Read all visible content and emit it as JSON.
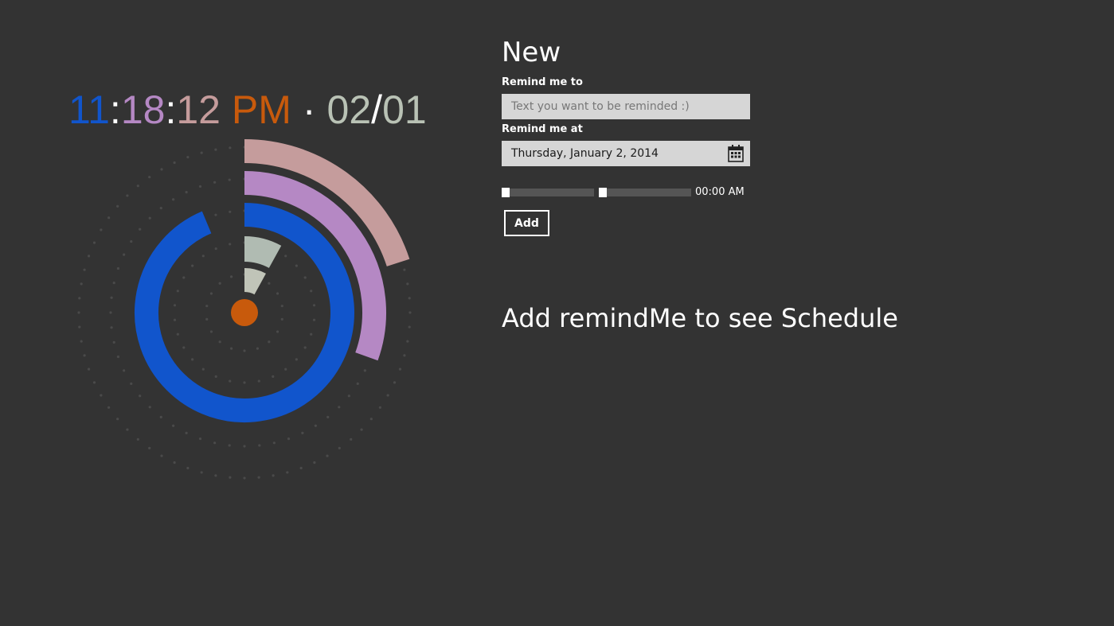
{
  "clock": {
    "hours": "11",
    "colon1": ":",
    "minutes": "18",
    "colon2": ":",
    "seconds": "12",
    "ampm": "PM",
    "separator": "·",
    "month": "02",
    "slash": "/",
    "day": "01",
    "colors": {
      "hours": "#1155cc",
      "colon": "#ffffff",
      "minutes": "#b588c4",
      "seconds": "#c59c9c",
      "ampm": "#c85a0c",
      "separator": "#ffffff",
      "date": "#b9c2b5"
    }
  },
  "clock_graphic": {
    "hour_ring_color": "#1155cc",
    "minute_ring_color": "#b588c4",
    "second_ring_color": "#c59c9c",
    "date_wedge_color": "#b0bbb2",
    "center_dot_color": "#c85a0c",
    "hour_fraction": 0.937,
    "minute_fraction": 0.305,
    "second_fraction": 0.2,
    "month_fraction": 0.16,
    "day_fraction": 0.16
  },
  "form": {
    "title": "New",
    "remind_to_label": "Remind me to",
    "remind_to_placeholder": "Text you want to be reminded :)",
    "remind_at_label": "Remind me at",
    "date_value": "Thursday, January 2, 2014",
    "time_value": "00:00 AM",
    "hour_slider_value": 0,
    "minute_slider_value": 0,
    "add_label": "Add"
  },
  "schedule": {
    "empty_message": "Add remindMe to see Schedule"
  }
}
